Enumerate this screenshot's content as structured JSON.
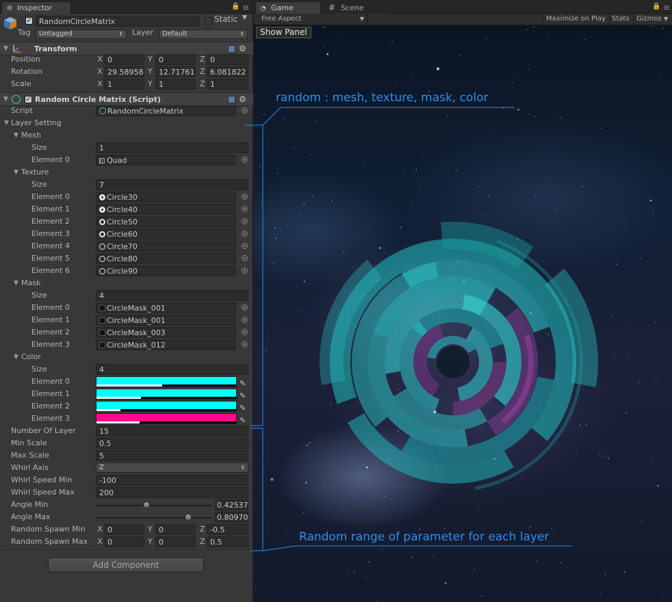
{
  "inspector": {
    "tab_label": "Inspector",
    "object_name": "RandomCircleMatrix",
    "static_label": "Static",
    "tag_label": "Tag",
    "tag_value": "Untagged",
    "layer_label": "Layer",
    "layer_value": "Default",
    "transform": {
      "title": "Transform",
      "position_label": "Position",
      "position": {
        "x": "0",
        "y": "0",
        "z": "0"
      },
      "rotation_label": "Rotation",
      "rotation": {
        "x": "29.58958",
        "y": "12.71761",
        "z": "6.081822"
      },
      "scale_label": "Scale",
      "scale": {
        "x": "1",
        "y": "1",
        "z": "1"
      }
    },
    "script_component": {
      "title": "Random Circle Matrix (Script)",
      "script_label": "Script",
      "script_value": "RandomCircleMatrix",
      "layer_setting_label": "Layer Setting",
      "mesh": {
        "label": "Mesh",
        "size_label": "Size",
        "size": "1",
        "elements": [
          {
            "label": "Element 0",
            "value": "Quad"
          }
        ]
      },
      "texture": {
        "label": "Texture",
        "size_label": "Size",
        "size": "7",
        "elements": [
          {
            "label": "Element 0",
            "value": "Circle30"
          },
          {
            "label": "Element 1",
            "value": "Circle40"
          },
          {
            "label": "Element 2",
            "value": "Circle50"
          },
          {
            "label": "Element 3",
            "value": "Circle60"
          },
          {
            "label": "Element 4",
            "value": "Circle70"
          },
          {
            "label": "Element 5",
            "value": "Circle80"
          },
          {
            "label": "Element 6",
            "value": "Circle90"
          }
        ]
      },
      "mask": {
        "label": "Mask",
        "size_label": "Size",
        "size": "4",
        "elements": [
          {
            "label": "Element 0",
            "value": "CircleMask_001"
          },
          {
            "label": "Element 1",
            "value": "CircleMask_001"
          },
          {
            "label": "Element 2",
            "value": "CircleMask_003"
          },
          {
            "label": "Element 3",
            "value": "CircleMask_012"
          }
        ]
      },
      "color": {
        "label": "Color",
        "size_label": "Size",
        "size": "4",
        "elements": [
          {
            "label": "Element 0",
            "color": "#00ffff",
            "alpha": 0.47
          },
          {
            "label": "Element 1",
            "color": "#00ffff",
            "alpha": 0.32
          },
          {
            "label": "Element 2",
            "color": "#00ffff",
            "alpha": 0.17
          },
          {
            "label": "Element 3",
            "color": "#ff0a8c",
            "alpha": 0.31
          }
        ]
      },
      "number_of_layer_label": "Number Of Layer",
      "number_of_layer": "15",
      "min_scale_label": "Min Scale",
      "min_scale": "0.5",
      "max_scale_label": "Max Scale",
      "max_scale": "5",
      "whirl_axis_label": "Whirl Axis",
      "whirl_axis": "Z",
      "whirl_speed_min_label": "Whirl Speed Min",
      "whirl_speed_min": "-100",
      "whirl_speed_max_label": "Whirl Speed Max",
      "whirl_speed_max": "200",
      "angle_min_label": "Angle Min",
      "angle_min": "0.42537",
      "angle_min_fraction": 0.43,
      "angle_max_label": "Angle Max",
      "angle_max": "0.80970",
      "angle_max_fraction": 0.81,
      "random_spawn_min_label": "Random Spawn Min",
      "random_spawn_min": {
        "x": "0",
        "y": "0",
        "z": "-0.5"
      },
      "random_spawn_max_label": "Random Spawn Max",
      "random_spawn_max": {
        "x": "0",
        "y": "0",
        "z": "0.5"
      }
    },
    "add_component_label": "Add Component"
  },
  "game": {
    "tab_game": "Game",
    "tab_scene": "Scene",
    "aspect": "Free Aspect",
    "maximize": "Maximize on Play",
    "stats": "Stats",
    "gizmos": "Gizmos",
    "show_panel": "Show Panel"
  },
  "annotations": {
    "top": "random : mesh, texture, mask, color",
    "bottom": "Random range of parameter for each layer",
    "color": "#2a8ff0"
  },
  "labels": {
    "x": "X",
    "y": "Y",
    "z": "Z"
  }
}
